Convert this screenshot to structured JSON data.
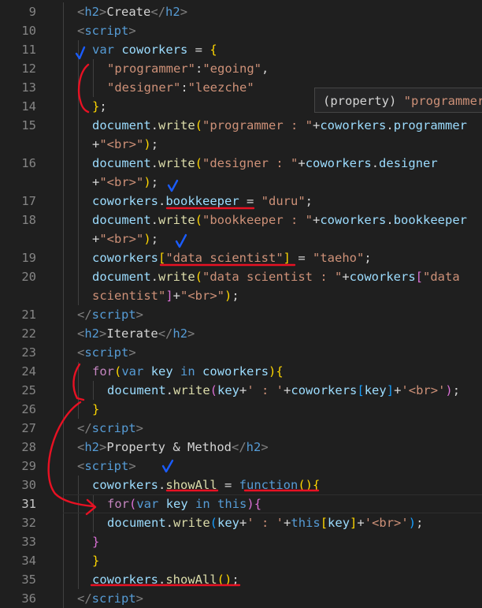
{
  "lines": [
    {
      "num": "9",
      "indent": 98,
      "tokens": [
        [
          "tag",
          "<"
        ],
        [
          "tn",
          "h2"
        ],
        [
          "tag",
          ">"
        ],
        [
          "txt",
          "Create"
        ],
        [
          "tag",
          "</"
        ],
        [
          "tn",
          "h2"
        ],
        [
          "tag",
          ">"
        ]
      ]
    },
    {
      "num": "10",
      "indent": 98,
      "tokens": [
        [
          "tag",
          "<"
        ],
        [
          "tn",
          "script"
        ],
        [
          "tag",
          ">"
        ]
      ]
    },
    {
      "num": "11",
      "indent": 117,
      "tokens": [
        [
          "kw",
          "var"
        ],
        [
          "op",
          " "
        ],
        [
          "var",
          "coworkers"
        ],
        [
          "op",
          " = "
        ],
        [
          "b1",
          "{"
        ]
      ]
    },
    {
      "num": "12",
      "indent": 136,
      "tokens": [
        [
          "str",
          "\"programmer\""
        ],
        [
          "op",
          ":"
        ],
        [
          "str",
          "\"egoing\""
        ],
        [
          "op",
          ","
        ]
      ]
    },
    {
      "num": "13",
      "indent": 136,
      "tokens": [
        [
          "str",
          "\"designer\""
        ],
        [
          "op",
          ":"
        ],
        [
          "str",
          "\"leezche\""
        ]
      ]
    },
    {
      "num": "14",
      "indent": 117,
      "tokens": [
        [
          "b1",
          "}"
        ],
        [
          "op",
          ";"
        ]
      ]
    },
    {
      "num": "15",
      "indent": 117,
      "tokens": [
        [
          "var",
          "document"
        ],
        [
          "op",
          "."
        ],
        [
          "fn",
          "write"
        ],
        [
          "b1",
          "("
        ],
        [
          "str",
          "\"programmer : \""
        ],
        [
          "op",
          "+"
        ],
        [
          "var",
          "coworkers"
        ],
        [
          "op",
          "."
        ],
        [
          "var",
          "programmer"
        ]
      ]
    },
    {
      "num": "",
      "indent": 117,
      "tokens": [
        [
          "op",
          "+"
        ],
        [
          "str",
          "\"<br>\""
        ],
        [
          "b1",
          ")"
        ],
        [
          "op",
          ";"
        ]
      ]
    },
    {
      "num": "16",
      "indent": 117,
      "tokens": [
        [
          "var",
          "document"
        ],
        [
          "op",
          "."
        ],
        [
          "fn",
          "write"
        ],
        [
          "b1",
          "("
        ],
        [
          "str",
          "\"designer : \""
        ],
        [
          "op",
          "+"
        ],
        [
          "var",
          "coworkers"
        ],
        [
          "op",
          "."
        ],
        [
          "var",
          "designer"
        ]
      ]
    },
    {
      "num": "",
      "indent": 117,
      "tokens": [
        [
          "op",
          "+"
        ],
        [
          "str",
          "\"<br>\""
        ],
        [
          "b1",
          ")"
        ],
        [
          "op",
          ";"
        ]
      ]
    },
    {
      "num": "17",
      "indent": 117,
      "tokens": [
        [
          "var",
          "coworkers"
        ],
        [
          "op",
          "."
        ],
        [
          "var",
          "bookkeeper"
        ],
        [
          "op",
          " = "
        ],
        [
          "str",
          "\"duru\""
        ],
        [
          "op",
          ";"
        ]
      ]
    },
    {
      "num": "18",
      "indent": 117,
      "tokens": [
        [
          "var",
          "document"
        ],
        [
          "op",
          "."
        ],
        [
          "fn",
          "write"
        ],
        [
          "b1",
          "("
        ],
        [
          "str",
          "\"bookkeeper : \""
        ],
        [
          "op",
          "+"
        ],
        [
          "var",
          "coworkers"
        ],
        [
          "op",
          "."
        ],
        [
          "var",
          "bookkeeper"
        ]
      ]
    },
    {
      "num": "",
      "indent": 117,
      "tokens": [
        [
          "op",
          "+"
        ],
        [
          "str",
          "\"<br>\""
        ],
        [
          "b1",
          ")"
        ],
        [
          "op",
          ";"
        ]
      ]
    },
    {
      "num": "19",
      "indent": 117,
      "tokens": [
        [
          "var",
          "coworkers"
        ],
        [
          "b1",
          "["
        ],
        [
          "str",
          "\"data scientist\""
        ],
        [
          "b1",
          "]"
        ],
        [
          "op",
          " = "
        ],
        [
          "str",
          "\"taeho\""
        ],
        [
          "op",
          ";"
        ]
      ]
    },
    {
      "num": "20",
      "indent": 117,
      "tokens": [
        [
          "var",
          "document"
        ],
        [
          "op",
          "."
        ],
        [
          "fn",
          "write"
        ],
        [
          "b1",
          "("
        ],
        [
          "str",
          "\"data scientist : \""
        ],
        [
          "op",
          "+"
        ],
        [
          "var",
          "coworkers"
        ],
        [
          "b2",
          "["
        ],
        [
          "str",
          "\"data"
        ]
      ]
    },
    {
      "num": "",
      "indent": 117,
      "tokens": [
        [
          "str",
          "scientist\""
        ],
        [
          "b2",
          "]"
        ],
        [
          "op",
          "+"
        ],
        [
          "str",
          "\"<br>\""
        ],
        [
          "b1",
          ")"
        ],
        [
          "op",
          ";"
        ]
      ]
    },
    {
      "num": "21",
      "indent": 98,
      "tokens": [
        [
          "tag",
          "</"
        ],
        [
          "tn",
          "script"
        ],
        [
          "tag",
          ">"
        ]
      ]
    },
    {
      "num": "22",
      "indent": 98,
      "tokens": [
        [
          "tag",
          "<"
        ],
        [
          "tn",
          "h2"
        ],
        [
          "tag",
          ">"
        ],
        [
          "txt",
          "Iterate"
        ],
        [
          "tag",
          "</"
        ],
        [
          "tn",
          "h2"
        ],
        [
          "tag",
          ">"
        ]
      ]
    },
    {
      "num": "23",
      "indent": 98,
      "tokens": [
        [
          "tag",
          "<"
        ],
        [
          "tn",
          "script"
        ],
        [
          "tag",
          ">"
        ]
      ]
    },
    {
      "num": "24",
      "indent": 117,
      "tokens": [
        [
          "ctl",
          "for"
        ],
        [
          "b1",
          "("
        ],
        [
          "kw",
          "var"
        ],
        [
          "op",
          " "
        ],
        [
          "var",
          "key"
        ],
        [
          "op",
          " "
        ],
        [
          "kw",
          "in"
        ],
        [
          "op",
          " "
        ],
        [
          "var",
          "coworkers"
        ],
        [
          "b1",
          ")"
        ],
        [
          "b1",
          "{"
        ]
      ]
    },
    {
      "num": "25",
      "indent": 136,
      "tokens": [
        [
          "var",
          "document"
        ],
        [
          "op",
          "."
        ],
        [
          "fn",
          "write"
        ],
        [
          "b2",
          "("
        ],
        [
          "var",
          "key"
        ],
        [
          "op",
          "+"
        ],
        [
          "str",
          "' : '"
        ],
        [
          "op",
          "+"
        ],
        [
          "var",
          "coworkers"
        ],
        [
          "b3",
          "["
        ],
        [
          "var",
          "key"
        ],
        [
          "b3",
          "]"
        ],
        [
          "op",
          "+"
        ],
        [
          "str",
          "'<br>'"
        ],
        [
          "b2",
          ")"
        ],
        [
          "op",
          ";"
        ]
      ]
    },
    {
      "num": "26",
      "indent": 117,
      "tokens": [
        [
          "b1",
          "}"
        ]
      ]
    },
    {
      "num": "27",
      "indent": 98,
      "tokens": [
        [
          "tag",
          "</"
        ],
        [
          "tn",
          "script"
        ],
        [
          "tag",
          ">"
        ]
      ]
    },
    {
      "num": "28",
      "indent": 98,
      "tokens": [
        [
          "tag",
          "<"
        ],
        [
          "tn",
          "h2"
        ],
        [
          "tag",
          ">"
        ],
        [
          "txt",
          "Property & Method"
        ],
        [
          "tag",
          "</"
        ],
        [
          "tn",
          "h2"
        ],
        [
          "tag",
          ">"
        ]
      ]
    },
    {
      "num": "29",
      "indent": 98,
      "tokens": [
        [
          "tag",
          "<"
        ],
        [
          "tn",
          "script"
        ],
        [
          "tag",
          ">"
        ]
      ]
    },
    {
      "num": "30",
      "indent": 117,
      "tokens": [
        [
          "var",
          "coworkers"
        ],
        [
          "op",
          "."
        ],
        [
          "fn",
          "showAll"
        ],
        [
          "op",
          " = "
        ],
        [
          "kw",
          "function"
        ],
        [
          "b1",
          "("
        ],
        [
          "b1",
          ")"
        ],
        [
          "b1",
          "{"
        ]
      ]
    },
    {
      "num": "31",
      "indent": 136,
      "active": true,
      "tokens": [
        [
          "ctl",
          "for"
        ],
        [
          "b2",
          "("
        ],
        [
          "kw",
          "var"
        ],
        [
          "op",
          " "
        ],
        [
          "var",
          "key"
        ],
        [
          "op",
          " "
        ],
        [
          "kw",
          "in"
        ],
        [
          "op",
          " "
        ],
        [
          "kw",
          "this"
        ],
        [
          "b2",
          ")"
        ],
        [
          "b2",
          "{"
        ]
      ]
    },
    {
      "num": "32",
      "indent": 136,
      "tokens": [
        [
          "var",
          "document"
        ],
        [
          "op",
          "."
        ],
        [
          "fn",
          "write"
        ],
        [
          "b3",
          "("
        ],
        [
          "var",
          "key"
        ],
        [
          "op",
          "+"
        ],
        [
          "str",
          "' : '"
        ],
        [
          "op",
          "+"
        ],
        [
          "kw",
          "this"
        ],
        [
          "b1",
          "["
        ],
        [
          "var",
          "key"
        ],
        [
          "b1",
          "]"
        ],
        [
          "op",
          "+"
        ],
        [
          "str",
          "'<br>'"
        ],
        [
          "b3",
          ")"
        ],
        [
          "op",
          ";"
        ]
      ]
    },
    {
      "num": "33",
      "indent": 117,
      "tokens": [
        [
          "b2",
          "}"
        ]
      ]
    },
    {
      "num": "34",
      "indent": 117,
      "tokens": [
        [
          "b1",
          "}"
        ]
      ]
    },
    {
      "num": "35",
      "indent": 117,
      "tokens": [
        [
          "var",
          "coworkers"
        ],
        [
          "op",
          "."
        ],
        [
          "fn",
          "showAll"
        ],
        [
          "b1",
          "("
        ],
        [
          "b1",
          ")"
        ],
        [
          "op",
          ";"
        ]
      ]
    },
    {
      "num": "36",
      "indent": 98,
      "tokens": [
        [
          "tag",
          "</"
        ],
        [
          "tn",
          "script"
        ],
        [
          "tag",
          ">"
        ]
      ]
    }
  ],
  "hover": {
    "prefix": "(property) ",
    "value": "\"programmer"
  },
  "colors": {
    "background": "#1f1f1f",
    "annotation_red": "#e81123",
    "annotation_blue": "#1a5cff"
  }
}
